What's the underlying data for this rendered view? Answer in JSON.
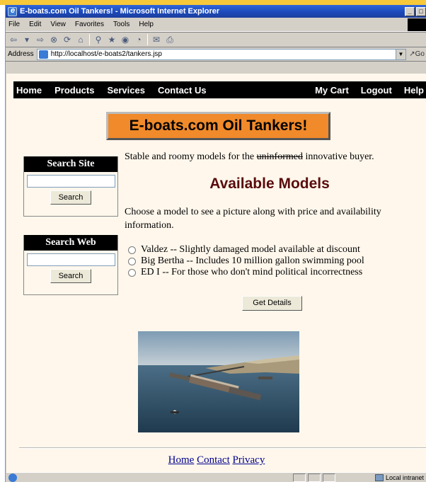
{
  "window": {
    "title": "E-boats.com Oil Tankers! - Microsoft Internet Explorer",
    "min_label": "_",
    "max_label": "□"
  },
  "menu": [
    "File",
    "Edit",
    "View",
    "Favorites",
    "Tools",
    "Help"
  ],
  "address": {
    "label": "Address",
    "url": "http://localhost/e-boats2/tankers.jsp",
    "go_label": "Go"
  },
  "nav": {
    "left": [
      "Home",
      "Products",
      "Services",
      "Contact Us"
    ],
    "right": [
      "My Cart",
      "Logout",
      "Help"
    ]
  },
  "banner": "E-boats.com Oil Tankers!",
  "search_site": {
    "title": "Search Site",
    "button": "Search"
  },
  "search_web": {
    "title": "Search Web",
    "button": "Search"
  },
  "intro": {
    "before": "Stable and roomy models for the ",
    "struck": "uninformed",
    "after": " innovative buyer."
  },
  "models_heading": "Available Models",
  "choose_text": "Choose a model to see a picture along with price and availability information.",
  "models": [
    "Valdez -- Slightly damaged model available at discount",
    "Big Bertha -- Includes 10 million gallon swimming pool",
    "ED I -- For those who don't mind political incorrectness"
  ],
  "details_button": "Get Details",
  "footer_links": [
    "Home",
    "Contact",
    "Privacy"
  ],
  "status": {
    "zone": "Local intranet"
  }
}
